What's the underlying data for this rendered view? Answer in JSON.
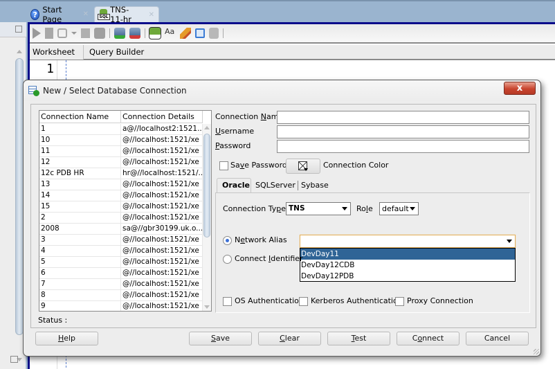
{
  "ide": {
    "doc_tabs": [
      {
        "label": "Start Page",
        "icon": "help-icon",
        "active": false
      },
      {
        "label": "TNS-11-hr",
        "icon": "sql-worksheet-icon",
        "active": true
      }
    ],
    "toolbar_icons": [
      "run-statement-icon",
      "run-script-icon",
      "autotrace-icon",
      "dropdown-arrow-icon",
      "explain-plan-icon",
      "sql-tuning-icon",
      "commit-icon",
      "rollback-icon",
      "unshared-worksheet-icon",
      "to-upper-lower-icon",
      "clear-icon",
      "sql-history-icon",
      "format-icon"
    ],
    "editor_tabs": [
      "Worksheet",
      "Query Builder"
    ],
    "line_number": "1"
  },
  "dialog": {
    "title": "New / Select Database Connection",
    "close_glyph": "x",
    "table": {
      "columns": [
        "Connection Name",
        "Connection Details"
      ],
      "rows": [
        [
          "1",
          "a@//localhost2:1521..."
        ],
        [
          "10",
          "@//localhost:1521/xe"
        ],
        [
          "11",
          "@//localhost:1521/xe"
        ],
        [
          "12",
          "@//localhost:1521/xe"
        ],
        [
          "12c PDB HR",
          "hr@//localhost:1521/..."
        ],
        [
          "13",
          "@//localhost:1521/xe"
        ],
        [
          "14",
          "@//localhost:1521/xe"
        ],
        [
          "15",
          "@//localhost:1521/xe"
        ],
        [
          "2",
          "@//localhost:1521/xe"
        ],
        [
          "2008",
          "sa@//gbr30199.uk.o..."
        ],
        [
          "3",
          "@//localhost:1521/xe"
        ],
        [
          "4",
          "@//localhost:1521/xe"
        ],
        [
          "5",
          "@//localhost:1521/xe"
        ],
        [
          "6",
          "@//localhost:1521/xe"
        ],
        [
          "7",
          "@//localhost:1521/xe"
        ],
        [
          "8",
          "@//localhost:1521/xe"
        ],
        [
          "9",
          "@//localhost:1521/xe"
        ]
      ]
    },
    "status_label": "Status :",
    "form": {
      "connection_name": {
        "label_pre": "Connection ",
        "label_key": "N",
        "label_post": "ame",
        "value": ""
      },
      "username": {
        "label_pre": "",
        "label_key": "U",
        "label_post": "sername",
        "value": ""
      },
      "password": {
        "label_pre": "",
        "label_key": "P",
        "label_post": "assword",
        "value": ""
      },
      "save_password": {
        "label_pre": "Sa",
        "label_key": "v",
        "label_post": "e Password",
        "checked": false
      },
      "connection_color_label": "Connection Color"
    },
    "db_tabs": [
      "Oracle",
      "SQLServer",
      "Sybase"
    ],
    "oracle": {
      "connection_type": {
        "label_pre": "Connection Ty",
        "label_key": "p",
        "label_post": "e",
        "value": "TNS"
      },
      "role": {
        "label_pre": "Ro",
        "label_key": "l",
        "label_post": "e",
        "value": "default"
      },
      "network_alias": {
        "label_pre": "N",
        "label_key": "e",
        "label_post": "twork Alias",
        "selected": true,
        "value": ""
      },
      "connect_identifier": {
        "label_pre": "Connect ",
        "label_key": "I",
        "label_post": "dentifier",
        "selected": false
      },
      "alias_options": [
        "DevDay11",
        "DevDay12CDB",
        "DevDay12PDB"
      ],
      "alias_highlighted": "DevDay11",
      "os_auth": {
        "label": "OS Authentication",
        "checked": false
      },
      "kerberos_auth": {
        "label": "Kerberos Authentication",
        "checked": false
      },
      "proxy_conn": {
        "label": "Proxy Connection",
        "checked": false
      }
    },
    "buttons": {
      "help": {
        "pre": "",
        "key": "H",
        "post": "elp"
      },
      "save": {
        "pre": "",
        "key": "S",
        "post": "ave"
      },
      "clear": {
        "pre": "",
        "key": "C",
        "post": "lear"
      },
      "test": {
        "pre": "",
        "key": "T",
        "post": "est"
      },
      "connect": {
        "pre": "C",
        "key": "o",
        "post": "nnect"
      },
      "cancel": {
        "pre": "Cancel",
        "key": "",
        "post": ""
      }
    }
  }
}
